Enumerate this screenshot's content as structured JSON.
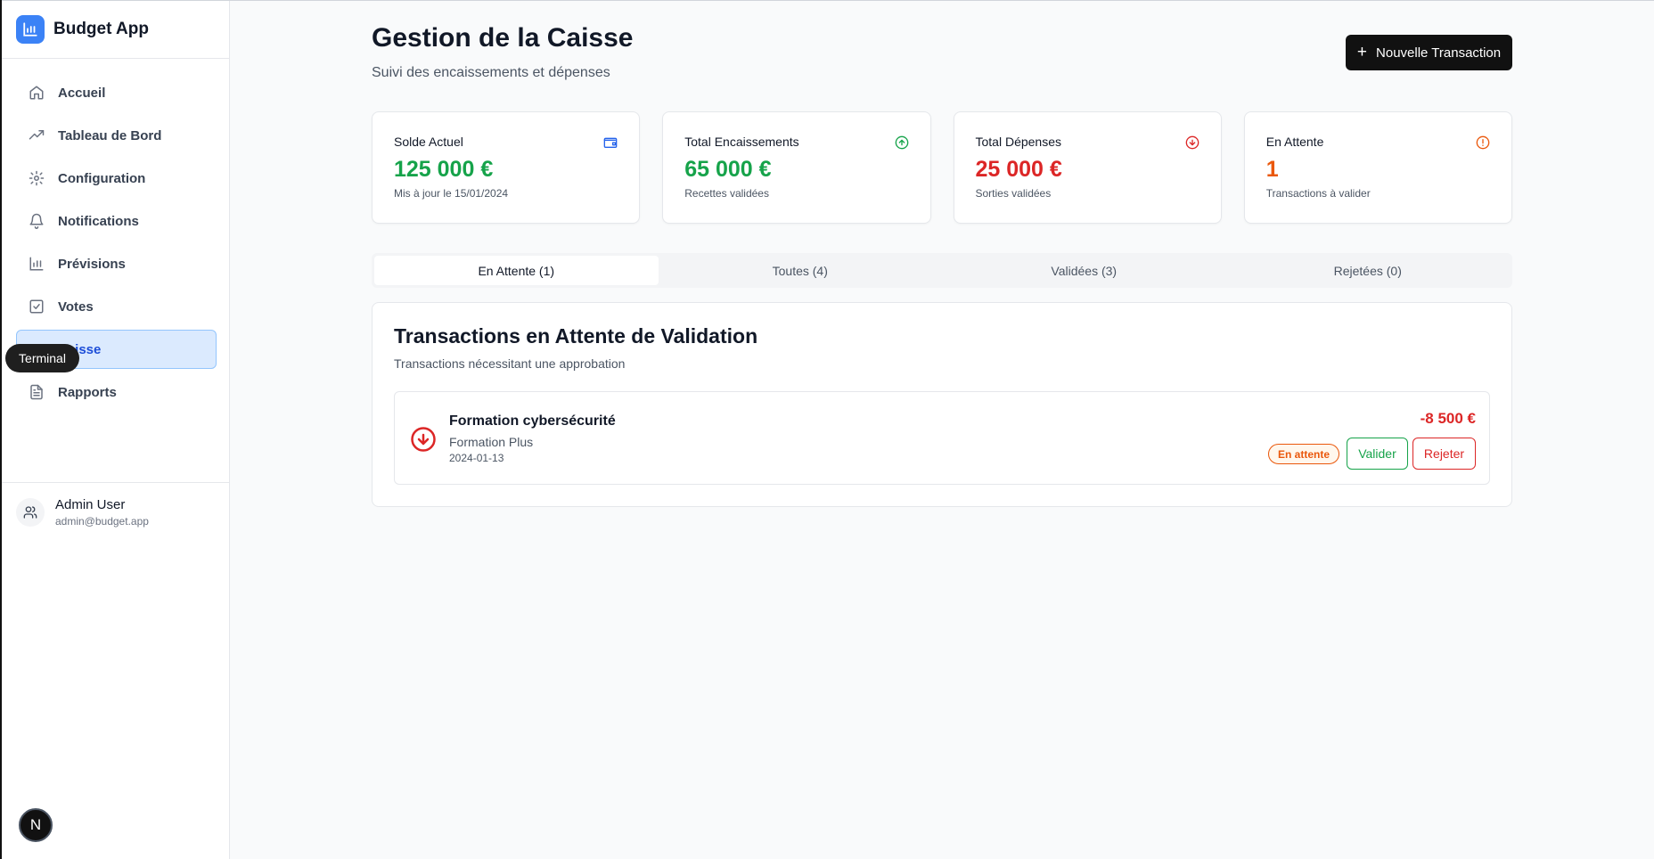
{
  "app": {
    "name": "Budget App",
    "logo_icon": "bar-chart-icon",
    "brand_color": "#3b82f6"
  },
  "sidebar": {
    "items": [
      {
        "label": "Accueil",
        "icon": "home-icon"
      },
      {
        "label": "Tableau de Bord",
        "icon": "trending-up-icon"
      },
      {
        "label": "Configuration",
        "icon": "gear-icon"
      },
      {
        "label": "Notifications",
        "icon": "bell-icon"
      },
      {
        "label": "Prévisions",
        "icon": "bar-chart-icon"
      },
      {
        "label": "Votes",
        "icon": "check-square-icon"
      },
      {
        "label": "Caisse",
        "icon": "cash-register-icon",
        "active": true
      },
      {
        "label": "Rapports",
        "icon": "file-text-icon"
      }
    ],
    "user": {
      "name": "Admin User",
      "email": "admin@budget.app",
      "icon": "users-icon"
    }
  },
  "tooltip": {
    "label": "Terminal"
  },
  "dev_badge": {
    "label": "N"
  },
  "header": {
    "title": "Gestion de la Caisse",
    "subtitle": "Suivi des encaissements et dépenses",
    "new_button": "Nouvelle Transaction"
  },
  "stats": [
    {
      "label": "Solde Actuel",
      "value": "125 000 €",
      "sub": "Mis à jour le 15/01/2024",
      "color": "#16a34a",
      "icon": "wallet-icon",
      "icon_color": "#2563eb"
    },
    {
      "label": "Total Encaissements",
      "value": "65 000 €",
      "sub": "Recettes validées",
      "color": "#16a34a",
      "icon": "arrow-up-circle-icon",
      "icon_color": "#16a34a"
    },
    {
      "label": "Total Dépenses",
      "value": "25 000 €",
      "sub": "Sorties validées",
      "color": "#dc2626",
      "icon": "arrow-down-circle-icon",
      "icon_color": "#dc2626"
    },
    {
      "label": "En Attente",
      "value": "1",
      "sub": "Transactions à valider",
      "color": "#ea580c",
      "icon": "alert-circle-icon",
      "icon_color": "#ea580c"
    }
  ],
  "tabs": [
    {
      "label": "En Attente (1)",
      "active": true
    },
    {
      "label": "Toutes (4)"
    },
    {
      "label": "Validées (3)"
    },
    {
      "label": "Rejetées (0)"
    }
  ],
  "panel": {
    "title": "Transactions en Attente de Validation",
    "description": "Transactions nécessitant une approbation",
    "transactions": [
      {
        "name": "Formation cybersécurité",
        "category": "Formation Plus",
        "date": "2024-01-13",
        "amount": "-8 500 €",
        "status": "En attente",
        "validate_label": "Valider",
        "reject_label": "Rejeter",
        "icon": "arrow-down-circle-icon"
      }
    ]
  }
}
